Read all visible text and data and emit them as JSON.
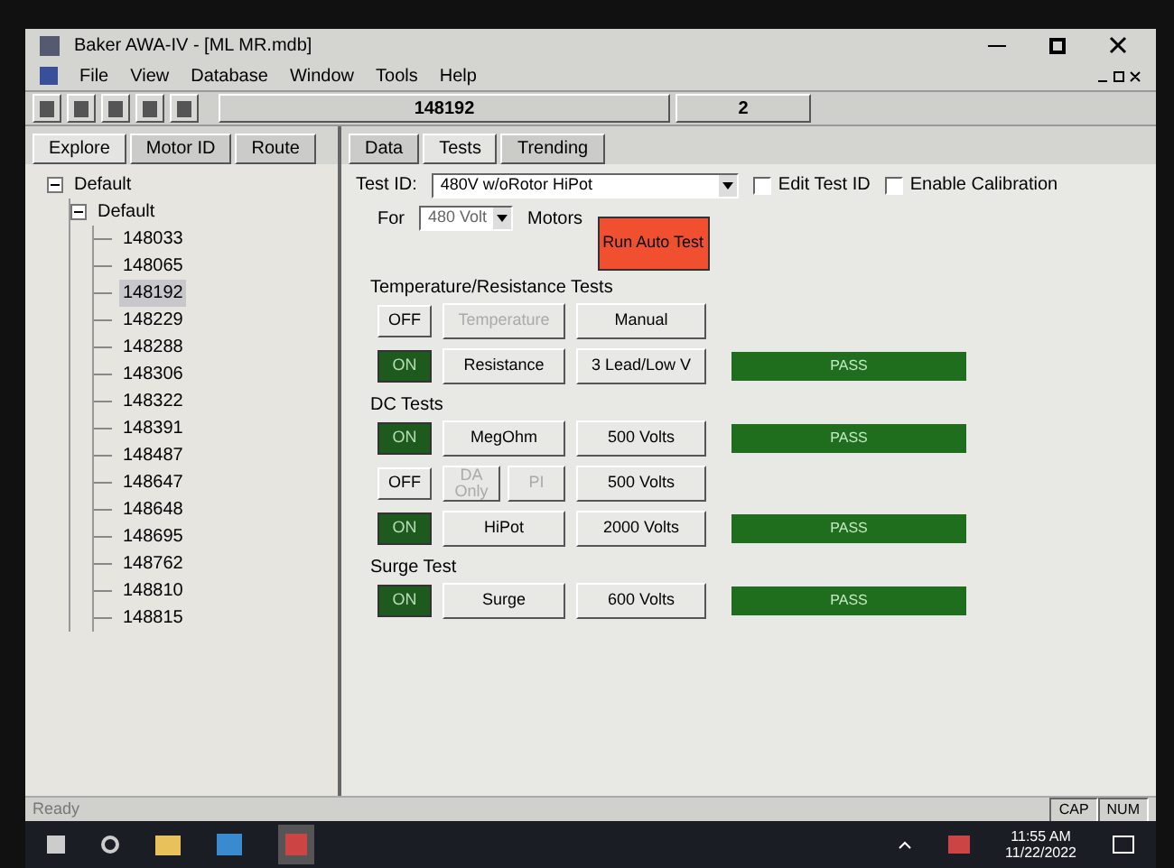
{
  "window": {
    "title": "Baker AWA-IV - [ML MR.mdb]"
  },
  "menu": [
    "File",
    "View",
    "Database",
    "Window",
    "Tools",
    "Help"
  ],
  "toolbar": {
    "motor_id": "148192",
    "field_2": "2"
  },
  "left_tabs": [
    {
      "label": "Explore",
      "selected": true
    },
    {
      "label": "Motor ID",
      "selected": false
    },
    {
      "label": "Route",
      "selected": false
    }
  ],
  "tree": [
    {
      "label": "Default",
      "expanded": true,
      "selected": false,
      "children": [
        {
          "label": "Default",
          "expanded": true,
          "selected": false,
          "children": [
            {
              "label": "148033",
              "selected": false
            },
            {
              "label": "148065",
              "selected": false
            },
            {
              "label": "148192",
              "selected": true
            },
            {
              "label": "148229",
              "selected": false
            },
            {
              "label": "148288",
              "selected": false
            },
            {
              "label": "148306",
              "selected": false
            },
            {
              "label": "148322",
              "selected": false
            },
            {
              "label": "148391",
              "selected": false
            },
            {
              "label": "148487",
              "selected": false
            },
            {
              "label": "148647",
              "selected": false
            },
            {
              "label": "148648",
              "selected": false
            },
            {
              "label": "148695",
              "selected": false
            },
            {
              "label": "148762",
              "selected": false
            },
            {
              "label": "148810",
              "selected": false
            },
            {
              "label": "148815",
              "selected": false
            }
          ]
        }
      ]
    }
  ],
  "right_tabs": [
    {
      "label": "Data",
      "selected": false
    },
    {
      "label": "Tests",
      "selected": true
    },
    {
      "label": "Trending",
      "selected": false
    }
  ],
  "test_id": {
    "label": "Test ID:",
    "value": "480V w/oRotor HiPot"
  },
  "edit_test_id": {
    "label": "Edit Test ID",
    "checked": false
  },
  "enable_calibration": {
    "label": "Enable Calibration",
    "checked": false
  },
  "for_label": "For",
  "voltage": "480 Volt",
  "motors_label": "Motors",
  "run_button": "Run Auto Test",
  "sections": [
    {
      "title": "Temperature/Resistance Tests",
      "rows": [
        {
          "toggle": "OFF",
          "on": false,
          "buttons": [
            {
              "label": "Temperature",
              "disabled": true
            }
          ],
          "setting": "Manual"
        },
        {
          "toggle": "ON",
          "on": true,
          "buttons": [
            {
              "label": "Resistance",
              "disabled": false
            }
          ],
          "setting": "3 Lead/Low V",
          "result": "PASS"
        }
      ]
    },
    {
      "title": "DC Tests",
      "rows": [
        {
          "toggle": "ON",
          "on": true,
          "buttons": [
            {
              "label": "MegOhm",
              "disabled": false
            }
          ],
          "setting": "500 Volts",
          "result": "PASS"
        },
        {
          "toggle": "OFF",
          "on": false,
          "buttons": [
            {
              "label": "DA Only",
              "disabled": true
            },
            {
              "label": "PI",
              "disabled": true
            }
          ],
          "setting": "500 Volts"
        },
        {
          "toggle": "ON",
          "on": true,
          "buttons": [
            {
              "label": "HiPot",
              "disabled": false
            }
          ],
          "setting": "2000 Volts",
          "result": "PASS"
        }
      ]
    },
    {
      "title": "Surge Test",
      "rows": [
        {
          "toggle": "ON",
          "on": true,
          "buttons": [
            {
              "label": "Surge",
              "disabled": false
            }
          ],
          "setting": "600 Volts",
          "result": "PASS"
        }
      ]
    }
  ],
  "status_bar": {
    "text": "Ready",
    "indicators": [
      "CAP",
      "NUM"
    ]
  },
  "taskbar": {
    "time": "11:55 AM",
    "date": "11/22/2022"
  }
}
